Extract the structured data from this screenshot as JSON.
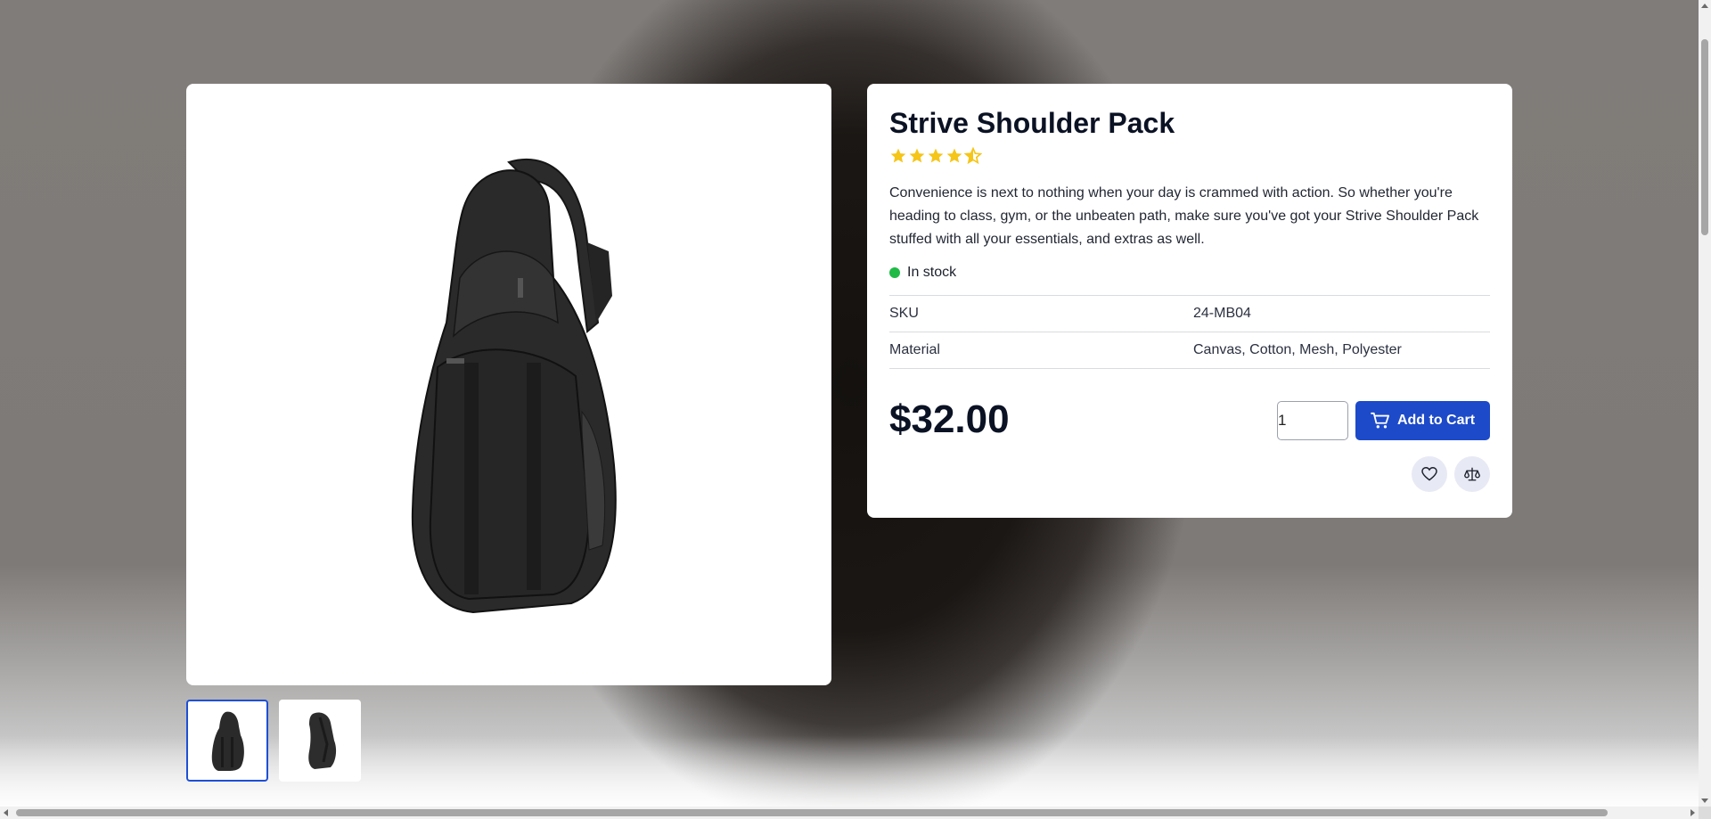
{
  "product": {
    "title": "Strive Shoulder Pack",
    "rating": 4.5,
    "rating_max": 5,
    "description": "Convenience is next to nothing when your day is crammed with action. So whether you're heading to class, gym, or the unbeaten path, make sure you've got your Strive Shoulder Pack stuffed with all your essentials, and extras as well.",
    "stock_status": "In stock",
    "specs": [
      {
        "label": "SKU",
        "value": "24-MB04"
      },
      {
        "label": "Material",
        "value": "Canvas, Cotton, Mesh, Polyester"
      }
    ],
    "price": "$32.00"
  },
  "purchase": {
    "quantity": "1",
    "add_to_cart_label": "Add to Cart"
  },
  "icons": {
    "cart": "cart-icon",
    "wishlist": "heart-icon",
    "compare": "scale-icon",
    "star": "star-icon"
  },
  "colors": {
    "accent": "#1d4ac9",
    "star": "#f5c518",
    "in_stock": "#1fba46",
    "thumb_active_border": "#1e4fd6"
  },
  "gallery": {
    "thumbnails": [
      "front",
      "side"
    ],
    "active_index": 0
  }
}
